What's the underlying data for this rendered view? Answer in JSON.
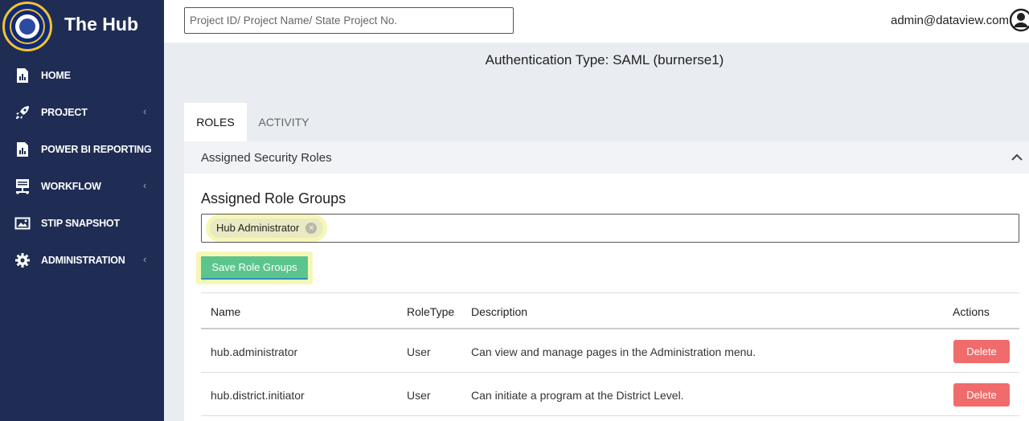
{
  "brand": {
    "title": "The Hub"
  },
  "sidebar": {
    "items": [
      {
        "label": "HOME",
        "icon": "home-chart-icon",
        "has_submenu": false
      },
      {
        "label": "PROJECT",
        "icon": "rocket-icon",
        "has_submenu": true
      },
      {
        "label": "POWER BI REPORTING",
        "icon": "report-chart-icon",
        "has_submenu": true
      },
      {
        "label": "WORKFLOW",
        "icon": "workflow-icon",
        "has_submenu": true
      },
      {
        "label": "STIP SNAPSHOT",
        "icon": "image-icon",
        "has_submenu": false
      },
      {
        "label": "ADMINISTRATION",
        "icon": "gear-icon",
        "has_submenu": true
      }
    ]
  },
  "header": {
    "search_placeholder": "Project ID/ Project Name/ State Project No.",
    "user_email": "admin@dataview.com"
  },
  "auth": {
    "text": "Authentication Type: SAML (burnerse1)"
  },
  "tabs": [
    {
      "label": "ROLES",
      "active": true
    },
    {
      "label": "ACTIVITY",
      "active": false
    }
  ],
  "panel": {
    "title": "Assigned Security Roles",
    "section_title": "Assigned Role Groups",
    "chips": [
      {
        "label": "Hub Administrator"
      }
    ],
    "save_label": "Save Role Groups"
  },
  "table": {
    "headers": {
      "name": "Name",
      "role_type": "RoleType",
      "description": "Description",
      "actions": "Actions"
    },
    "rows": [
      {
        "name": "hub.administrator",
        "role_type": "User",
        "description": "Can view and manage pages in the Administration menu.",
        "action_label": "Delete"
      },
      {
        "name": "hub.district.initiator",
        "role_type": "User",
        "description": "Can initiate a program at the District Level.",
        "action_label": "Delete"
      }
    ]
  },
  "colors": {
    "sidebar_bg": "#1f2d54",
    "save_button": "#5cc58d",
    "delete_button": "#f06b6b",
    "highlight": "#eef078"
  }
}
